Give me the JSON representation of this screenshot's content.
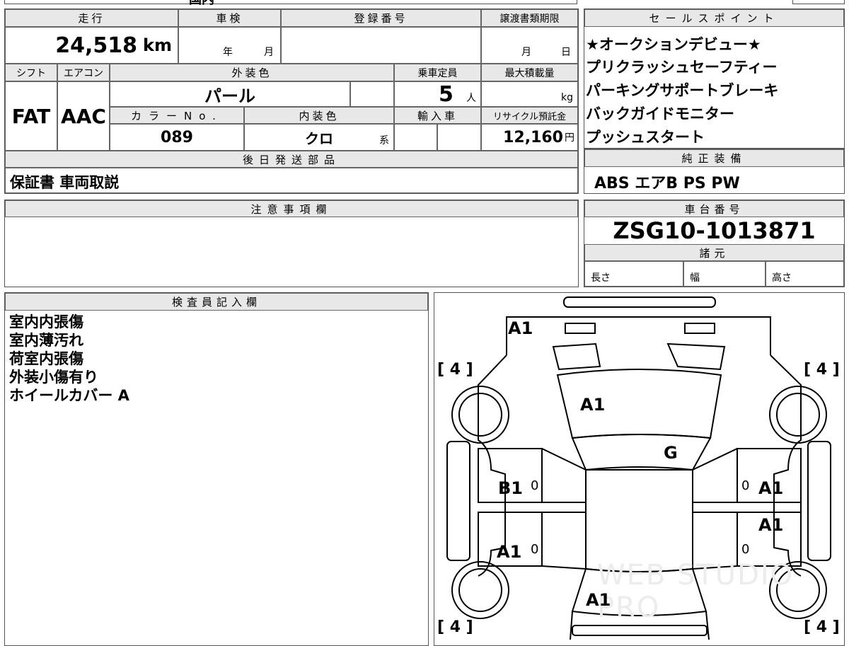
{
  "top_strip": {
    "partial_text": "国内"
  },
  "specs": {
    "mileage_label": "走行",
    "mileage_value": "24,518",
    "mileage_unit": "km",
    "inspection_label": "車検",
    "inspection_year": "年",
    "inspection_month": "月",
    "registration_label": "登録番号",
    "registration_value": "",
    "transfer_deadline_label": "譲渡書類期限",
    "transfer_month": "月",
    "transfer_day": "日",
    "shift_label": "シフト",
    "shift_value": "FAT",
    "aircon_label": "エアコン",
    "aircon_value": "AAC",
    "exterior_color_label": "外装色",
    "exterior_color_value": "パール",
    "capacity_label": "乗車定員",
    "capacity_value": "5",
    "capacity_unit": "人",
    "max_load_label": "最大積載量",
    "max_load_unit": "kg",
    "color_no_label": "カラーNo.",
    "color_no_value": "089",
    "interior_color_label": "内装色",
    "interior_color_value": "クロ",
    "interior_color_suffix": "系",
    "import_label": "輸入車",
    "recycle_label": "リサイクル預託金",
    "recycle_value": "12,160",
    "recycle_unit": "円",
    "later_parts_label": "後日発送部品",
    "later_parts_value": "保証書 車両取説"
  },
  "sales_points": {
    "label": "セールスポイント",
    "items": [
      "★オークションデビュー★",
      "プリクラッシュセーフティー",
      "パーキングサポートブレーキ",
      "バックガイドモニター",
      "プッシュスタート"
    ]
  },
  "equipment": {
    "label": "純正装備",
    "value": "ABS エアB PS PW"
  },
  "notes": {
    "label": "注意事項欄",
    "value": ""
  },
  "chassis": {
    "label": "車台番号",
    "value": "ZSG10-1013871"
  },
  "dimensions": {
    "label": "諸元",
    "length": "長さ",
    "width": "幅",
    "height": "高さ"
  },
  "inspector": {
    "label": "検査員記入欄",
    "items": [
      "室内内張傷",
      "室内薄汚れ",
      "荷室内張傷",
      "外装小傷有り",
      "ホイールカバー A"
    ]
  },
  "diagram": {
    "marks": {
      "rear_top": "A1",
      "rear_glass": "A1",
      "roof": "G",
      "left_front_door": "B1",
      "left_rear_door": "A1",
      "right_front_door": "A1",
      "right_rear_door": "A1",
      "hood": "A1"
    },
    "tire_tl": "[ 4 ]",
    "tire_tr": "[ 4 ]",
    "tire_bl": "[ 4 ]",
    "tire_br": "[ 4 ]",
    "zero": "0",
    "watermark": "WEB STUDIO PRO"
  }
}
